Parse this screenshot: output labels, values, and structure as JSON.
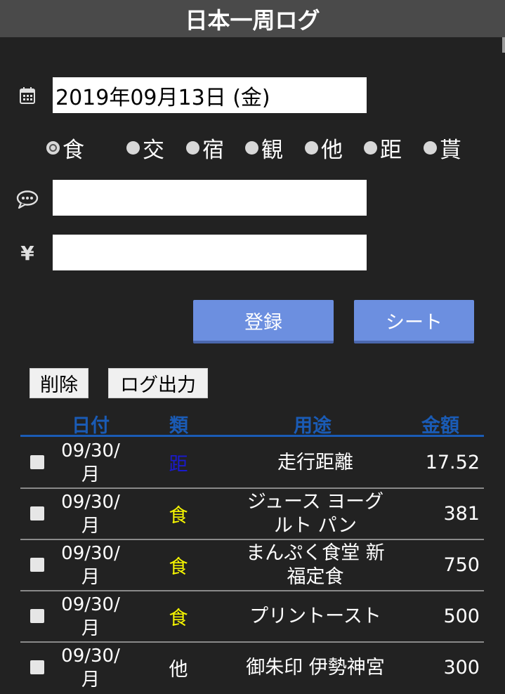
{
  "app": {
    "title": "日本一周ログ"
  },
  "form": {
    "date_value": "2019年09月13日 (金)",
    "memo_value": "",
    "amount_value": "",
    "yen_symbol": "¥"
  },
  "categories": [
    {
      "label": "食",
      "checked": true
    },
    {
      "label": "交",
      "checked": false
    },
    {
      "label": "宿",
      "checked": false
    },
    {
      "label": "観",
      "checked": false
    },
    {
      "label": "他",
      "checked": false
    },
    {
      "label": "距",
      "checked": false
    },
    {
      "label": "貰",
      "checked": false
    }
  ],
  "buttons": {
    "register": "登録",
    "sheet": "シート",
    "delete": "削除",
    "export_log": "ログ出力"
  },
  "table": {
    "headers": {
      "date": "日付",
      "category": "類",
      "purpose": "用途",
      "amount": "金額"
    },
    "rows": [
      {
        "date": "09/30/\n月",
        "category": "距",
        "category_color": "#1a1acc",
        "purpose": "走行距離",
        "amount": "17.52"
      },
      {
        "date": "09/30/\n月",
        "category": "食",
        "category_color": "#f5f500",
        "purpose": "ジュース ヨーグ\nルト パン",
        "amount": "381"
      },
      {
        "date": "09/30/\n月",
        "category": "食",
        "category_color": "#f5f500",
        "purpose": "まんぷく食堂 新\n福定食",
        "amount": "750"
      },
      {
        "date": "09/30/\n月",
        "category": "食",
        "category_color": "#f5f500",
        "purpose": "プリントースト",
        "amount": "500"
      },
      {
        "date": "09/30/\n月",
        "category": "他",
        "category_color": "#ffffff",
        "purpose": "御朱印 伊勢神宮",
        "amount": "300"
      }
    ]
  },
  "colors": {
    "background": "#222222",
    "title_bar": "#4a4a4a",
    "button_accent": "#6c8fe0",
    "header_accent": "#1a5bb5"
  },
  "icons": {
    "date": "calendar-icon",
    "memo": "speech-bubble-icon",
    "amount": "yen-icon"
  }
}
